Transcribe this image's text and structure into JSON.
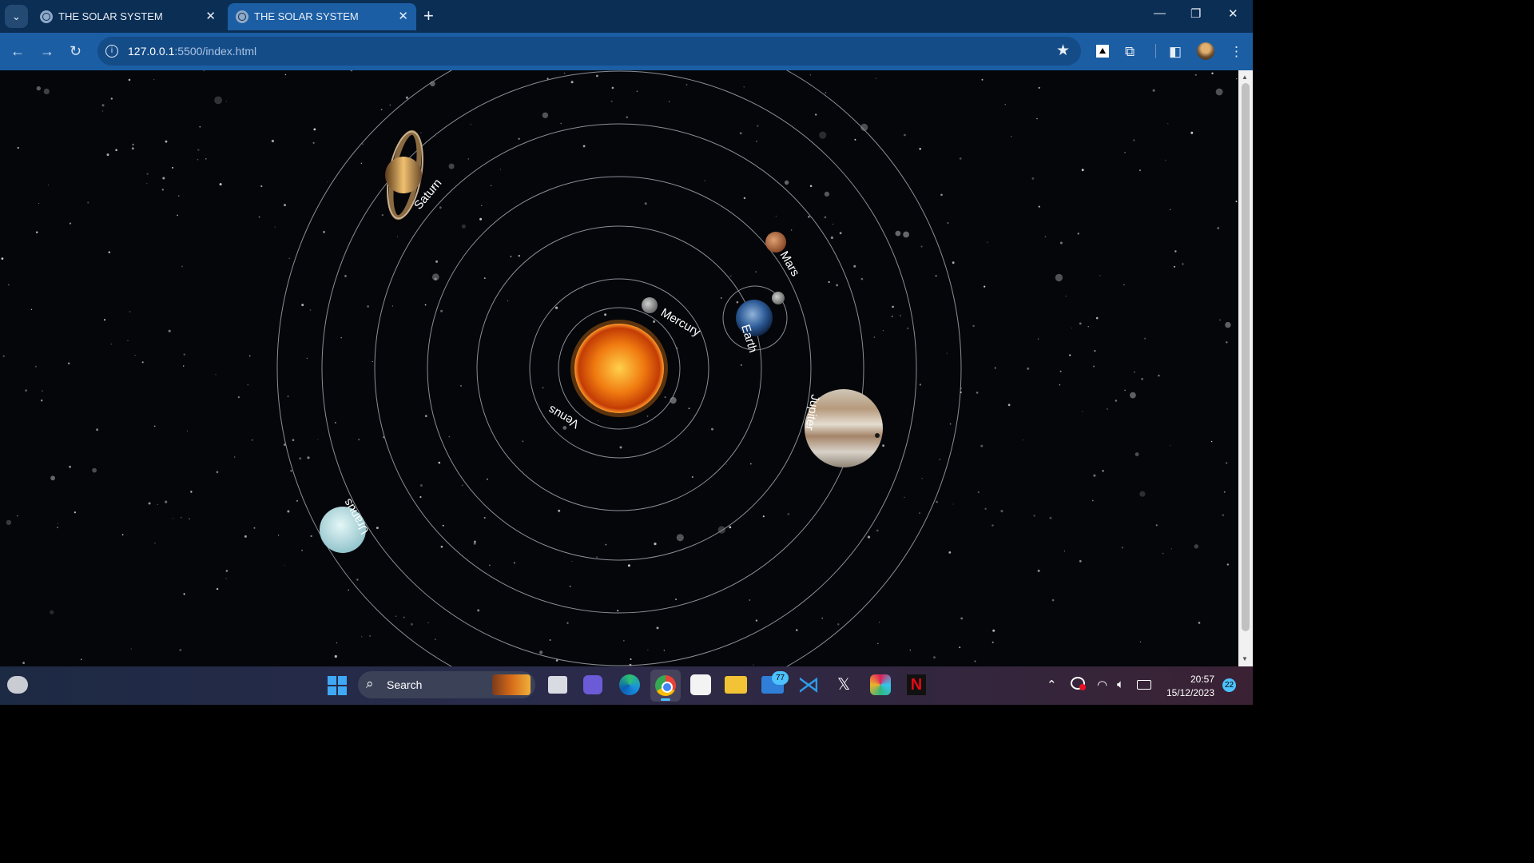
{
  "browser": {
    "tabs": [
      {
        "title": "THE SOLAR SYSTEM",
        "active": false
      },
      {
        "title": "THE SOLAR SYSTEM",
        "active": true
      }
    ],
    "url_host": "127.0.0.1",
    "url_path": ":5500/index.html"
  },
  "solar": {
    "planets": {
      "mercury": "Mercury",
      "venus": "Venus",
      "earth": "Earth",
      "mars": "Mars",
      "jupiter": "Jupiter",
      "saturn": "Saturn",
      "uranus": "Uranus"
    },
    "colors": {
      "sun": "#f07a10",
      "orbit": "#8a8f96",
      "space": "#04060a"
    }
  },
  "taskbar": {
    "search_label": "Search",
    "mail_badge": "77",
    "time": "20:57",
    "date": "15/12/2023",
    "notification_count": "22"
  }
}
